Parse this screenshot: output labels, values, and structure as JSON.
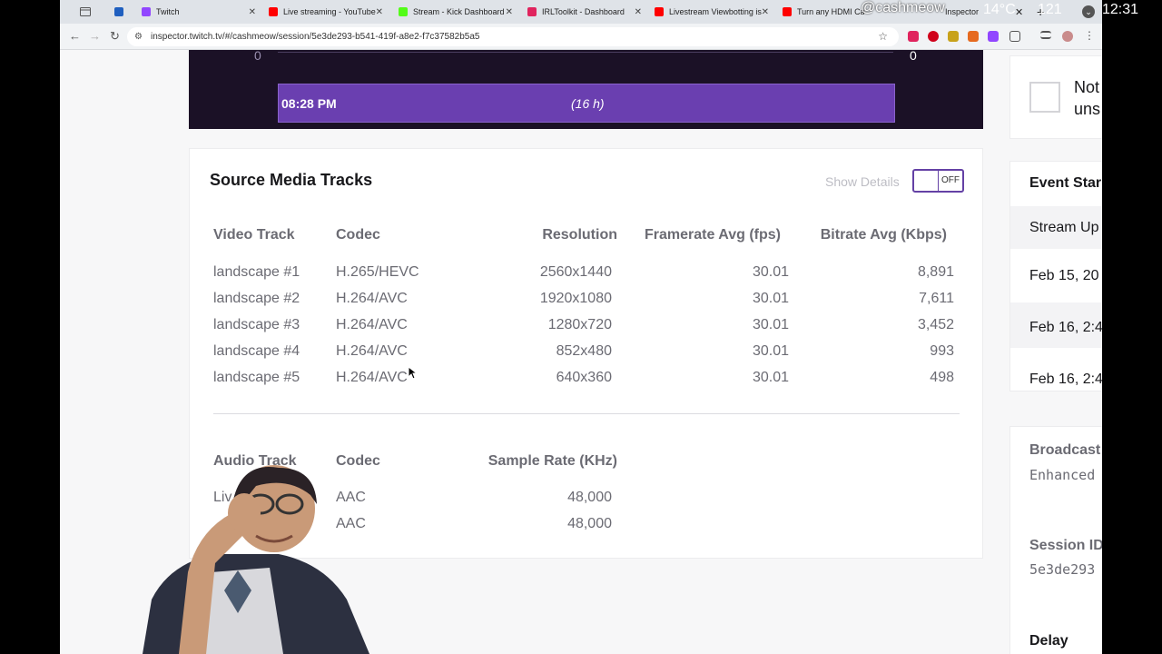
{
  "browser": {
    "tabs": [
      {
        "label": "",
        "color": "#1f5fbf"
      },
      {
        "label": "Twitch",
        "color": "#9146ff"
      },
      {
        "label": "Live streaming - YouTube",
        "color": "#ff0000"
      },
      {
        "label": "Stream - Kick Dashboard",
        "color": "#53fc18"
      },
      {
        "label": "IRLToolkit - Dashboard",
        "color": "#e0245e"
      },
      {
        "label": "Livestream Viewbotting is",
        "color": "#ff0000"
      },
      {
        "label": "Turn any HDMI Cam",
        "color": "#ff0000"
      },
      {
        "label": "Inspector",
        "color": "#9146ff"
      }
    ],
    "url": "inspector.twitch.tv/#/cashmeow/session/5e3de293-b541-419f-a8e2-f7c37582b5a5"
  },
  "os": {
    "handle": "@cashmeow",
    "temperature": "14°C",
    "count": "121",
    "clock": "12:31"
  },
  "timeline": {
    "left_value": "0",
    "right_value": "0",
    "start_time": "08:28 PM",
    "duration": "(16 h)"
  },
  "tracks_card": {
    "title": "Source Media Tracks",
    "show_details_label": "Show Details",
    "toggle_label": "OFF",
    "video_headers": [
      "Video Track",
      "Codec",
      "Resolution",
      "Framerate Avg (fps)",
      "Bitrate Avg (Kbps)"
    ],
    "video_rows": [
      {
        "track": "landscape #1",
        "codec": "H.265/HEVC",
        "resolution": "2560x1440",
        "framerate": "30.01",
        "bitrate": "8,891"
      },
      {
        "track": "landscape #2",
        "codec": "H.264/AVC",
        "resolution": "1920x1080",
        "framerate": "30.01",
        "bitrate": "7,611"
      },
      {
        "track": "landscape #3",
        "codec": "H.264/AVC",
        "resolution": "1280x720",
        "framerate": "30.01",
        "bitrate": "3,452"
      },
      {
        "track": "landscape #4",
        "codec": "H.264/AVC",
        "resolution": "852x480",
        "framerate": "30.01",
        "bitrate": "993"
      },
      {
        "track": "landscape #5",
        "codec": "H.264/AVC",
        "resolution": "640x360",
        "framerate": "30.01",
        "bitrate": "498"
      }
    ],
    "audio_headers": [
      "Audio Track",
      "Codec",
      "Sample Rate (KHz)"
    ],
    "audio_rows": [
      {
        "track": "Liv",
        "codec": "AAC",
        "sample_rate": "48,000"
      },
      {
        "track": "",
        "codec": "AAC",
        "sample_rate": "48,000"
      }
    ]
  },
  "right_column": {
    "notify_text_line1": "Not",
    "notify_text_line2": "uns",
    "event_title": "Event Star",
    "event_rows": [
      "Stream Up",
      "Feb 15, 20",
      "Feb 16, 2:4",
      "Feb 16, 2:4"
    ],
    "broadcaster_label": "Broadcast",
    "broadcaster_value": "Enhanced",
    "session_label": "Session ID",
    "session_value": "5e3de293",
    "delay_label": "Delay"
  }
}
